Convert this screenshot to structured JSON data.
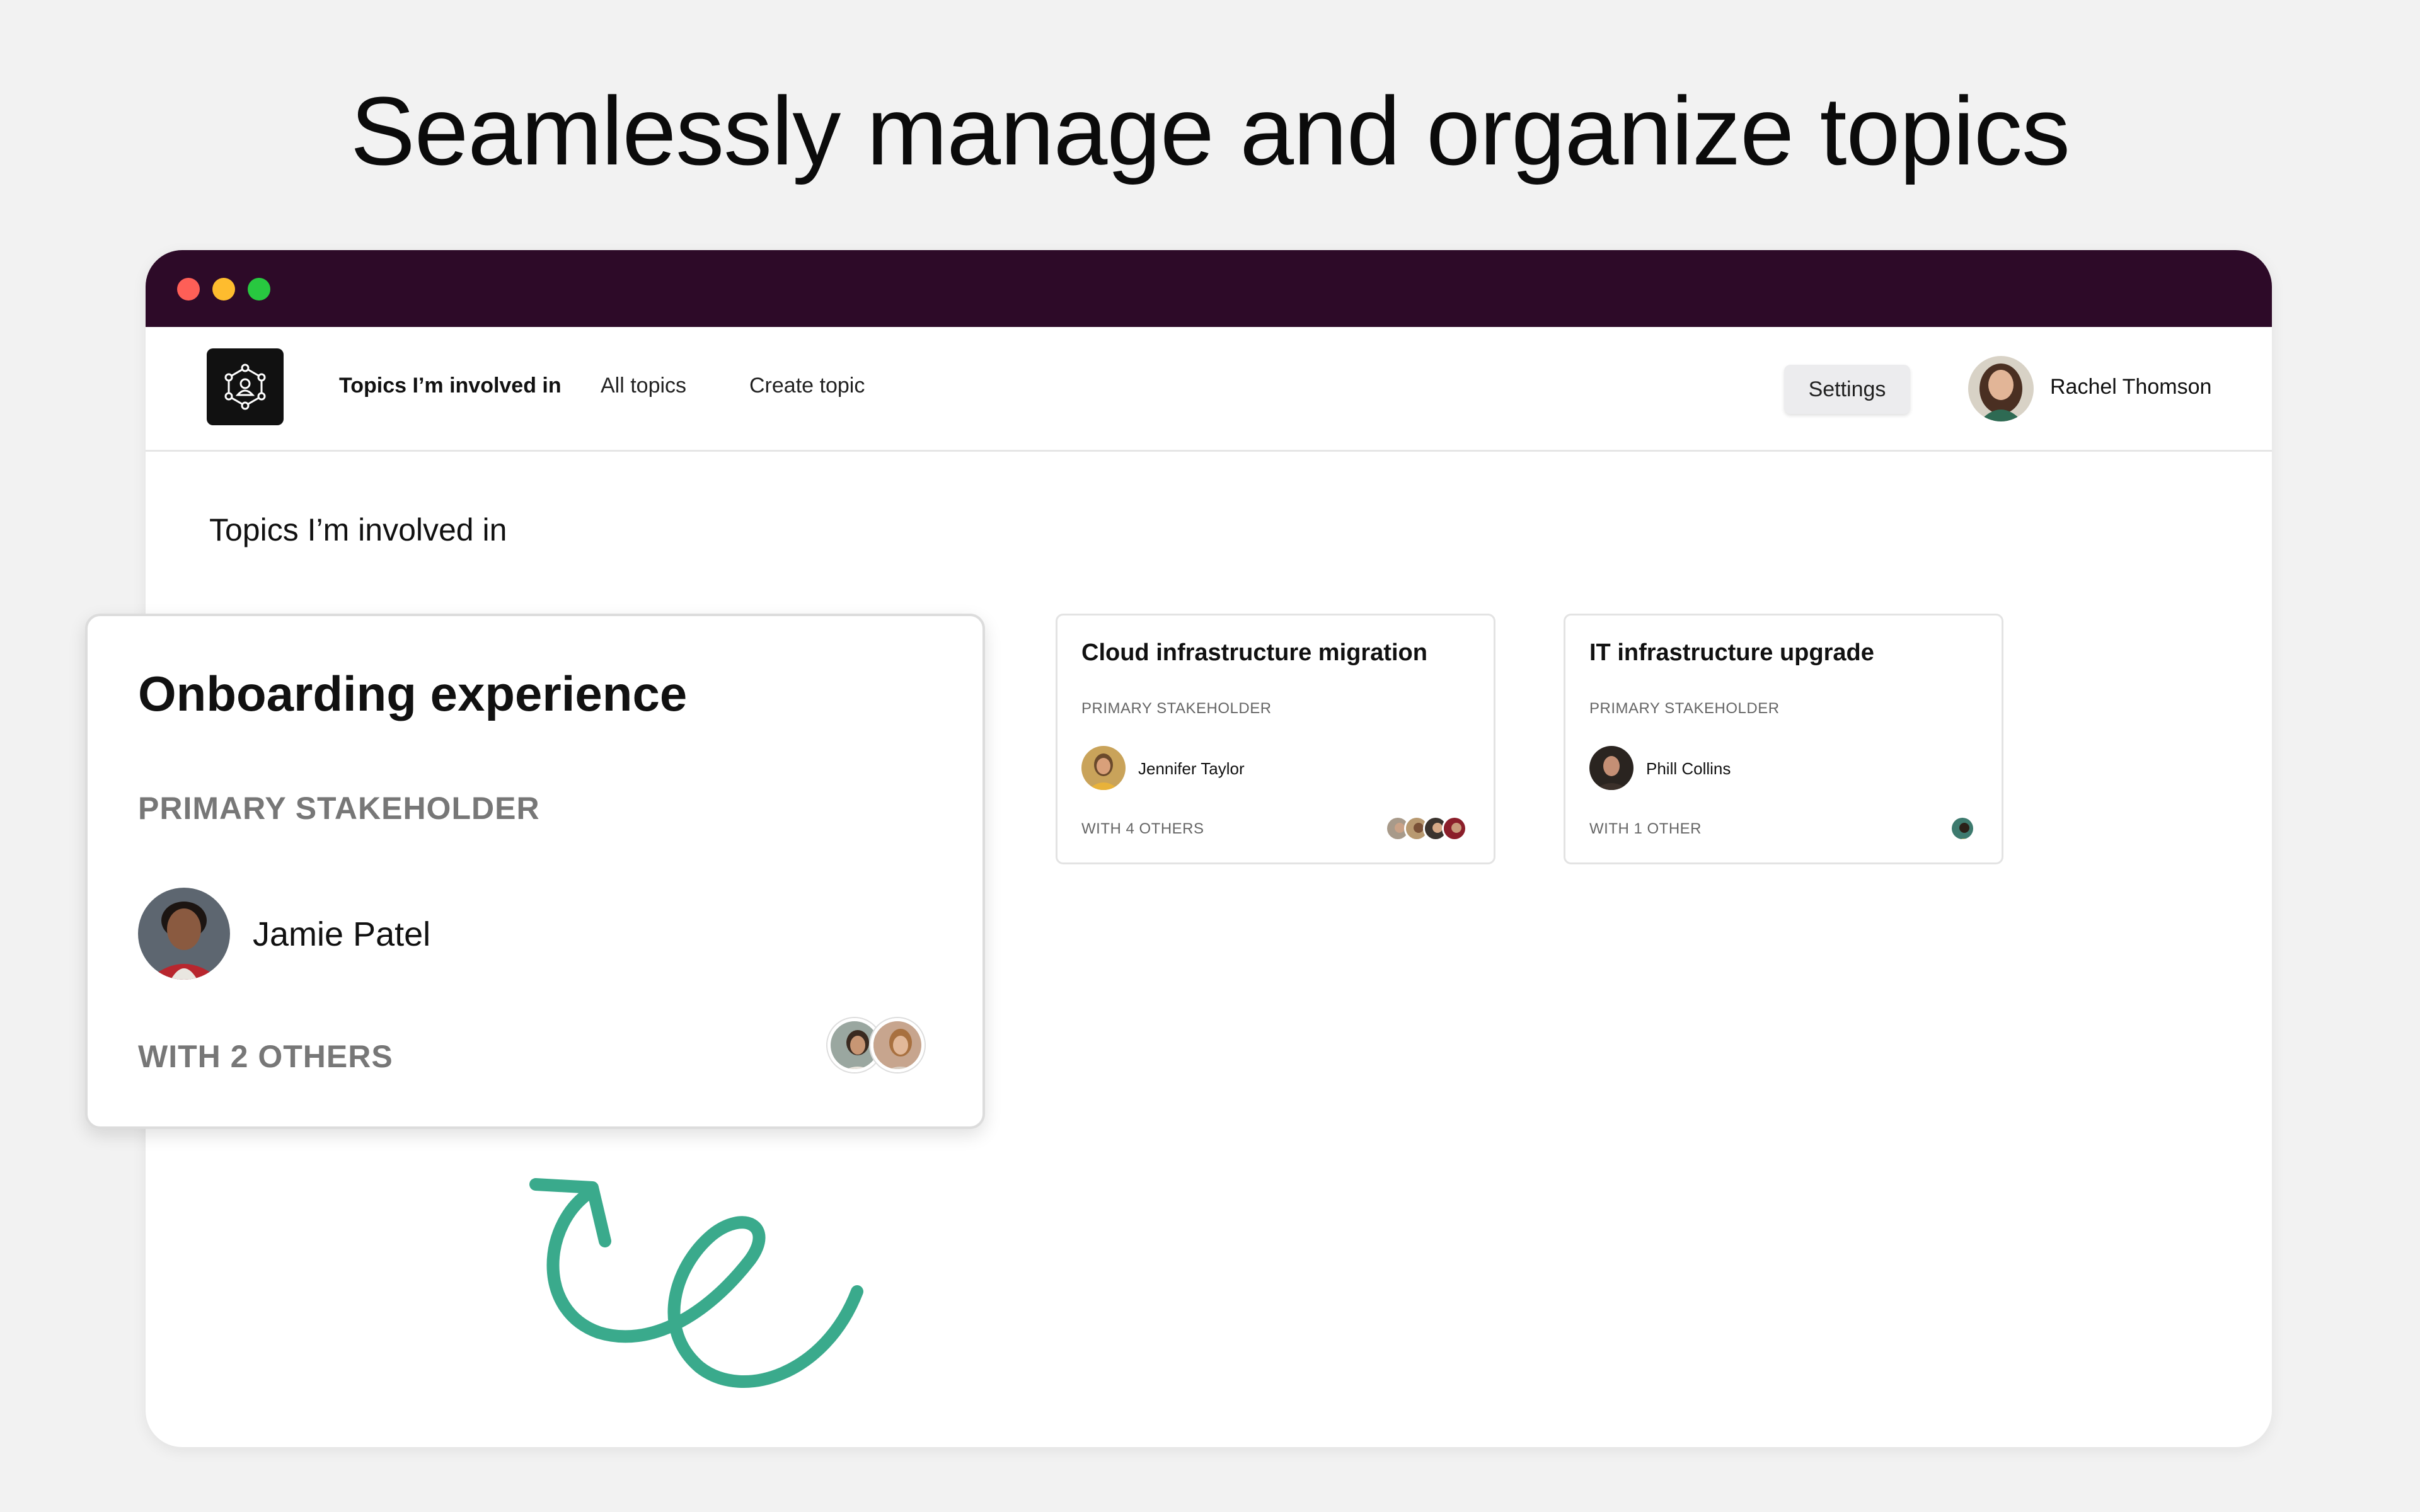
{
  "headline": "Seamlessly manage and organize topics",
  "nav": {
    "links": [
      "Topics I’m involved in",
      "All topics",
      "Create topic"
    ],
    "settings_label": "Settings",
    "user_name": "Rachel Thomson"
  },
  "section_title": "Topics I’m involved in",
  "featured_card": {
    "title": "Onboarding experience",
    "stakeholder_label": "PRIMARY STAKEHOLDER",
    "stakeholder_name": "Jamie Patel",
    "others_label": "WITH 2 OTHERS"
  },
  "cards": [
    {
      "title": "Cloud infrastructure migration",
      "stakeholder_label": "PRIMARY STAKEHOLDER",
      "stakeholder_name": "Jennifer Taylor",
      "others_label": "WITH 4 OTHERS"
    },
    {
      "title": "IT infrastructure upgrade",
      "stakeholder_label": "PRIMARY STAKEHOLDER",
      "stakeholder_name": "Phill Collins",
      "others_label": "WITH 1 OTHER"
    }
  ],
  "colors": {
    "titlebar": "#2d0a28",
    "accent_squiggle": "#3aaa8c",
    "traffic_red": "#fe5f57",
    "traffic_yellow": "#febc2e",
    "traffic_green": "#28c840"
  },
  "icons": {
    "logo": "network-user-icon",
    "user_avatar": "avatar"
  }
}
